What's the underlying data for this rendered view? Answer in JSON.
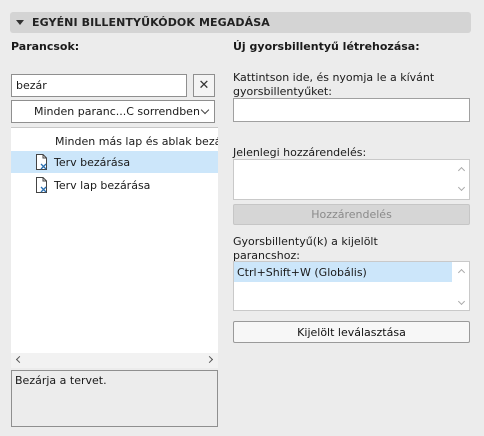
{
  "header": {
    "title": "EGYÉNI BILLENTYŰKÓDOK MEGADÁSA"
  },
  "left": {
    "commands_label": "Parancsok:",
    "search_value": "bezár",
    "clear_symbol": "✕",
    "sort_dropdown": "Minden paranc...C sorrendben",
    "list": [
      {
        "label": "Minden más lap és ablak bezárása",
        "icon": "none",
        "selected": false
      },
      {
        "label": "Terv bezárása",
        "icon": "document-close-icon",
        "selected": true
      },
      {
        "label": "Terv lap bezárása",
        "icon": "document-close-icon",
        "selected": false
      }
    ],
    "description": "Bezárja a tervet."
  },
  "right": {
    "new_shortcut_label": "Új gyorsbillentyű létrehozása:",
    "instruction": "Kattintson ide, és nyomja le a kívánt gyorsbillentyűket:",
    "shortcut_input_value": "",
    "current_assignment_label": "Jelenlegi hozzárendelés:",
    "assign_button": "Hozzárendelés",
    "shortcuts_for_selected_label": "Gyorsbillentyű(k) a kijelölt parancshoz:",
    "shortcuts": [
      "Ctrl+Shift+W (Globális)"
    ],
    "detach_button": "Kijelölt leválasztása"
  },
  "colors": {
    "selection": "#cce6fa",
    "header": "#d4d4d4",
    "background": "#ececec"
  }
}
